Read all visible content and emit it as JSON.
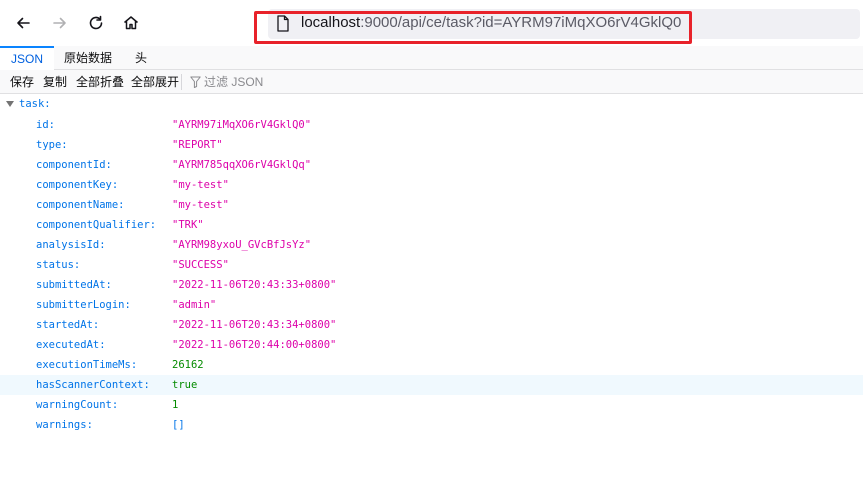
{
  "navbar": {
    "url_host": "localhost",
    "url_rest": ":9000/api/ce/task?id=AYRM97iMqXO6rV4GklQ0"
  },
  "tabs": [
    {
      "label": "JSON",
      "active": true
    },
    {
      "label": "原始数据",
      "active": false
    },
    {
      "label": "头",
      "active": false
    }
  ],
  "toolbar": {
    "save": "保存",
    "copy": "复制",
    "collapse_all": "全部折叠",
    "expand_all": "全部展开",
    "filter_placeholder": "过滤 JSON"
  },
  "tree": {
    "root_key": "task:",
    "rows": [
      {
        "key": "id:",
        "value": "\"AYRM97iMqXO6rV4GklQ0\"",
        "type": "string"
      },
      {
        "key": "type:",
        "value": "\"REPORT\"",
        "type": "string"
      },
      {
        "key": "componentId:",
        "value": "\"AYRM785qqXO6rV4GklQq\"",
        "type": "string"
      },
      {
        "key": "componentKey:",
        "value": "\"my-test\"",
        "type": "string"
      },
      {
        "key": "componentName:",
        "value": "\"my-test\"",
        "type": "string"
      },
      {
        "key": "componentQualifier:",
        "value": "\"TRK\"",
        "type": "string"
      },
      {
        "key": "analysisId:",
        "value": "\"AYRM98yxoU_GVcBfJsYz\"",
        "type": "string"
      },
      {
        "key": "status:",
        "value": "\"SUCCESS\"",
        "type": "string"
      },
      {
        "key": "submittedAt:",
        "value": "\"2022-11-06T20:43:33+0800\"",
        "type": "string"
      },
      {
        "key": "submitterLogin:",
        "value": "\"admin\"",
        "type": "string"
      },
      {
        "key": "startedAt:",
        "value": "\"2022-11-06T20:43:34+0800\"",
        "type": "string"
      },
      {
        "key": "executedAt:",
        "value": "\"2022-11-06T20:44:00+0800\"",
        "type": "string"
      },
      {
        "key": "executionTimeMs:",
        "value": "26162",
        "type": "number"
      },
      {
        "key": "hasScannerContext:",
        "value": "true",
        "type": "bool",
        "hover": true
      },
      {
        "key": "warningCount:",
        "value": "1",
        "type": "number"
      },
      {
        "key": "warnings:",
        "value": "[]",
        "type": "array"
      }
    ]
  },
  "colors": {
    "key": "#0074e8",
    "string": "#dd00a9",
    "number": "#058b00",
    "highlight_box": "#e8222a"
  }
}
